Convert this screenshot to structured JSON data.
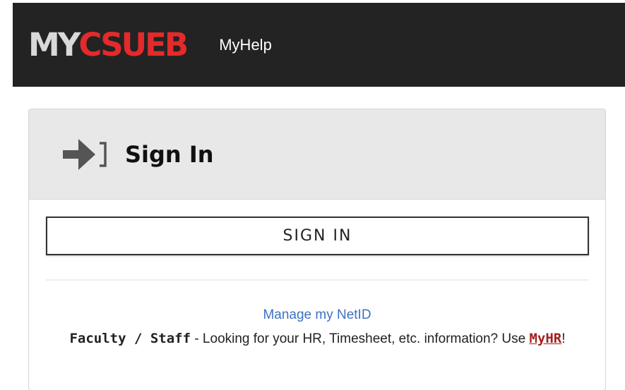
{
  "header": {
    "logo_my": "MY",
    "logo_csueb": "CSUEB",
    "nav_link": "MyHelp"
  },
  "card": {
    "title": "Sign In",
    "icon": "sign-in-arrow-icon",
    "signin_button_label": "SIGN IN",
    "manage_link": "Manage my NetID",
    "info_strong": "Faculty / Staff",
    "info_text": " - Looking for your HR, Timesheet, etc. information? Use ",
    "myhr_link": "MyHR",
    "info_suffix": "!"
  },
  "colors": {
    "topbar_bg": "#232323",
    "logo_red": "#e42a2a",
    "link_blue": "#3d72c2",
    "myhr_red": "#a52020"
  }
}
